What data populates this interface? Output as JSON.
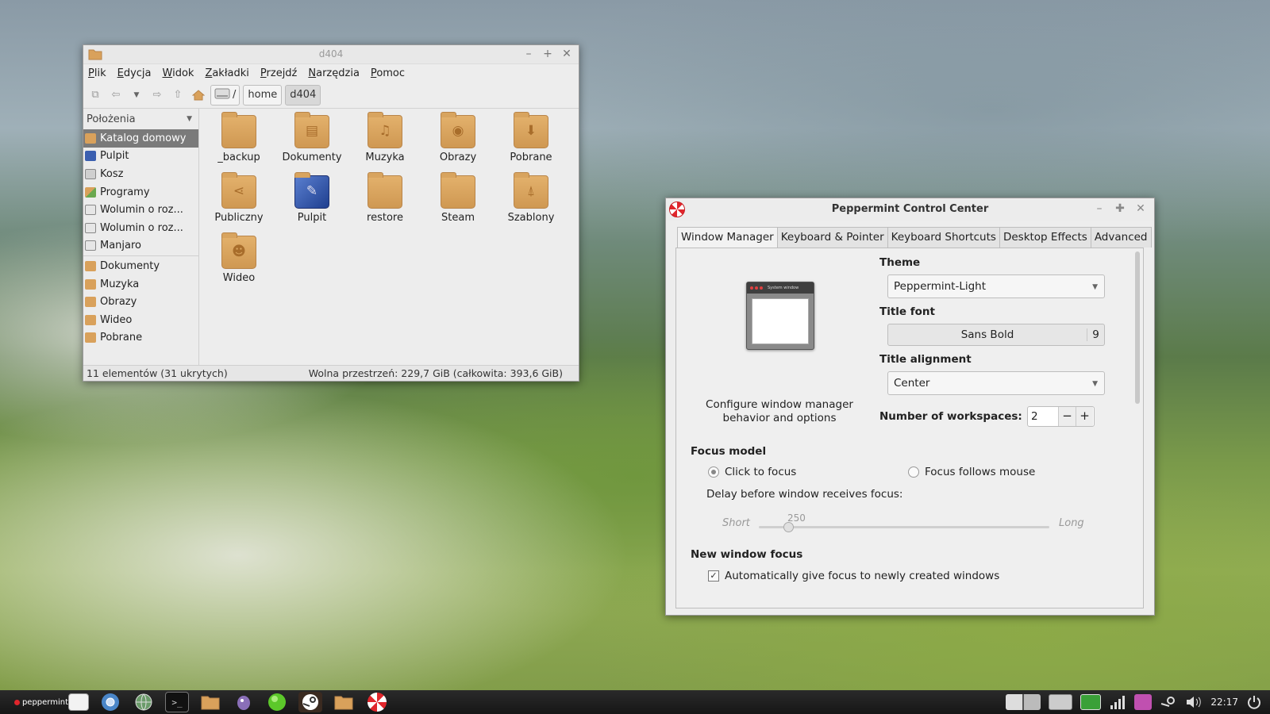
{
  "file_manager": {
    "title": "d404",
    "menu": [
      "Plik",
      "Edycja",
      "Widok",
      "Zakładki",
      "Przejdź",
      "Narzędzia",
      "Pomoc"
    ],
    "breadcrumbs": [
      "/",
      "home",
      "d404"
    ],
    "sidebar_header": "Położenia",
    "sidebar_items": [
      {
        "label": "Katalog domowy",
        "icon": "home-folder-icon",
        "selected": true
      },
      {
        "label": "Pulpit",
        "icon": "desktop-icon"
      },
      {
        "label": "Kosz",
        "icon": "trash-icon"
      },
      {
        "label": "Programy",
        "icon": "applications-icon"
      },
      {
        "label": "Wolumin o roz...",
        "icon": "drive-icon"
      },
      {
        "label": "Wolumin o roz...",
        "icon": "drive-icon"
      },
      {
        "label": "Manjaro",
        "icon": "drive-icon"
      },
      {
        "label": "Dokumenty",
        "icon": "documents-folder-icon"
      },
      {
        "label": "Muzyka",
        "icon": "music-folder-icon"
      },
      {
        "label": "Obrazy",
        "icon": "pictures-folder-icon"
      },
      {
        "label": "Wideo",
        "icon": "videos-folder-icon"
      },
      {
        "label": "Pobrane",
        "icon": "downloads-folder-icon"
      }
    ],
    "files": [
      {
        "name": "_backup",
        "icon": "folder-icon"
      },
      {
        "name": "Dokumenty",
        "icon": "documents-folder-icon"
      },
      {
        "name": "Muzyka",
        "icon": "music-folder-icon"
      },
      {
        "name": "Obrazy",
        "icon": "pictures-folder-icon"
      },
      {
        "name": "Pobrane",
        "icon": "downloads-folder-icon"
      },
      {
        "name": "Publiczny",
        "icon": "public-folder-icon"
      },
      {
        "name": "Pulpit",
        "icon": "desktop-folder-icon"
      },
      {
        "name": "restore",
        "icon": "folder-icon"
      },
      {
        "name": "Steam",
        "icon": "folder-icon"
      },
      {
        "name": "Szablony",
        "icon": "templates-folder-icon"
      },
      {
        "name": "Wideo",
        "icon": "videos-folder-icon"
      }
    ],
    "status_left": "11 elementów (31 ukrytych)",
    "status_right": "Wolna przestrzeń: 229,7 GiB (całkowita: 393,6 GiB)"
  },
  "control_center": {
    "title": "Peppermint Control Center",
    "tabs": [
      "Window Manager",
      "Keyboard & Pointer",
      "Keyboard Shortcuts",
      "Desktop Effects",
      "Advanced"
    ],
    "active_tab": "Window Manager",
    "preview_title": "System window",
    "description": "Configure window manager behavior and options",
    "theme_label": "Theme",
    "theme_value": "Peppermint-Light",
    "title_font_label": "Title font",
    "title_font_name": "Sans Bold",
    "title_font_size": "9",
    "title_alignment_label": "Title alignment",
    "title_alignment_value": "Center",
    "workspaces_label": "Number of workspaces:",
    "workspaces_value": "2",
    "focus_model_label": "Focus model",
    "click_to_focus": "Click to focus",
    "focus_follows_mouse": "Focus follows mouse",
    "focus_model_selected": "Click to focus",
    "delay_label": "Delay before window receives focus:",
    "slider_short": "Short",
    "slider_long": "Long",
    "slider_value": "250",
    "slider_fraction": 0.1,
    "new_window_focus_label": "New window focus",
    "auto_focus_label": "Automatically give focus to newly created windows",
    "auto_focus_checked": true
  },
  "taskbar": {
    "brand": "peppermint",
    "launchers": [
      "window-icon",
      "chromium-icon",
      "network-globe-icon",
      "terminal-icon",
      "folder-icon",
      "pidgin-icon",
      "green-orb-icon",
      "steam-icon",
      "folder-icon",
      "peppermint-icon"
    ],
    "tray": [
      "workspace-switcher-icon",
      "show-desktop-icon",
      "battery-icon",
      "signal-icon",
      "messaging-icon",
      "steam-tray-icon",
      "volume-icon"
    ],
    "clock": "22:17",
    "power": "power-icon"
  },
  "colors": {
    "selection": "#7a7a7a",
    "folder": "#d9a15b",
    "peppermint_red": "#e0262c",
    "taskbar": "#1e1e1e"
  }
}
